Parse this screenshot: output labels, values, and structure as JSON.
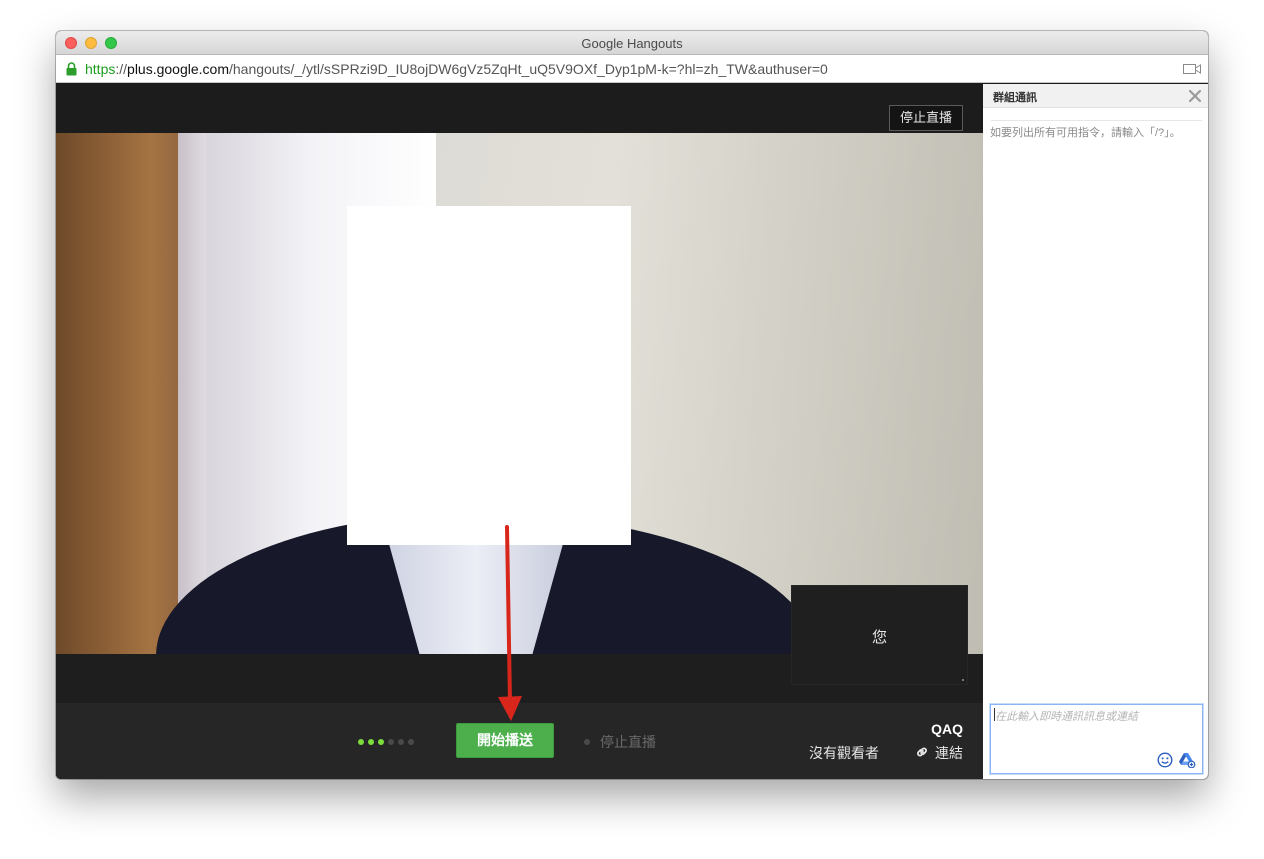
{
  "window": {
    "title": "Google Hangouts"
  },
  "address_bar": {
    "scheme": "https",
    "separator": "://",
    "host": "plus.google.com",
    "path": "/hangouts/_/ytl/sSPRzi9D_IU8ojDW6gVz5ZqHt_uQ5V9OXf_Dyp1pM-k=?hl=zh_TW&authuser=0"
  },
  "stage": {
    "stop_live_top_label": "停止直播",
    "self_tile_label": "您"
  },
  "controls": {
    "start_broadcast_label": "開始播送",
    "stop_live_label": "停止直播",
    "event_name": "QAQ",
    "viewers_label": "沒有觀看者",
    "link_label": "連結",
    "progress": {
      "active": 3,
      "total": 6
    }
  },
  "chat": {
    "title": "群組通訊",
    "hint": "如要列出所有可用指令，請輸入「/?」。",
    "input_placeholder": "在此輸入即時通訊訊息或連結"
  },
  "colors": {
    "accent_green": "#4caf4c",
    "arrow_red": "#d9261c",
    "dot_active": "#7cdd3c",
    "dot_inactive": "#4a4a4a"
  }
}
